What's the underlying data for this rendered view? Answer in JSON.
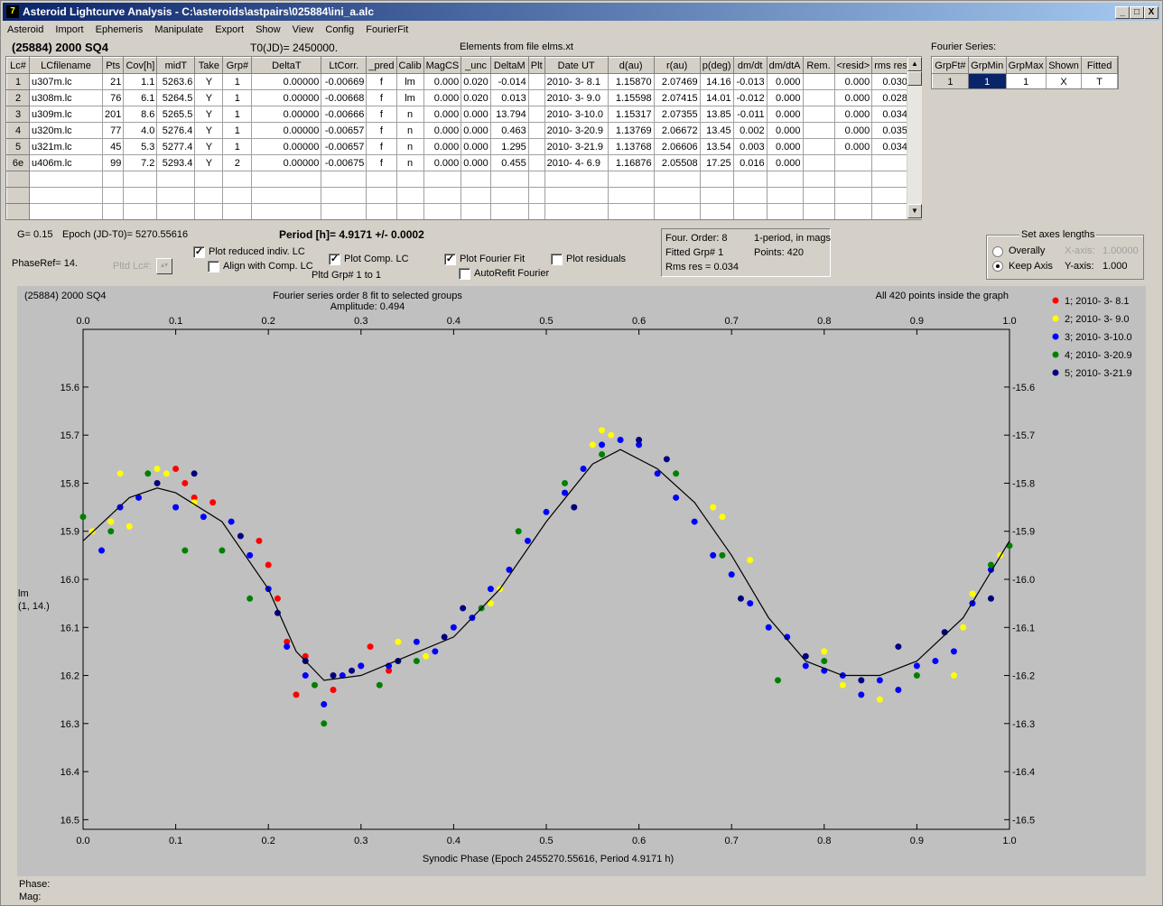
{
  "titlebar": {
    "icon_label": "7",
    "title": "Asteroid Lightcurve Analysis - C:\\asteroids\\astpairs\\025884\\ini_a.alc",
    "min_label": "_",
    "max_label": "□",
    "close_label": "X"
  },
  "menu": [
    "Asteroid",
    "Import",
    "Ephemeris",
    "Manipulate",
    "Export",
    "Show",
    "View",
    "Config",
    "FourierFit"
  ],
  "header": {
    "asteroid": "(25884) 2000 SQ4",
    "t0": "T0(JD)= 2450000.",
    "elements": "Elements from file elms.xt"
  },
  "lc_table": {
    "columns": [
      "Lc#",
      "LCfilename",
      "Pts",
      "Cov[h]",
      "midT",
      "Take",
      "Grp#",
      "DeltaT",
      "LtCorr.",
      "_pred",
      "Calib",
      "MagCS",
      "_unc",
      "DeltaM",
      "Plt",
      "Date UT",
      "d(au)",
      "r(au)",
      "p(deg)",
      "dm/dt",
      "dm/dtA",
      "Rem.",
      "<resid>",
      "rms res"
    ],
    "rows": [
      [
        "1",
        "u307m.lc",
        "21",
        "1.1",
        "5263.6",
        "Y",
        "1",
        "0.00000",
        "-0.00669",
        "f",
        "lm",
        "0.000",
        "0.020",
        "-0.014",
        "",
        "2010- 3- 8.1",
        "1.15870",
        "2.07469",
        "14.16",
        "-0.013",
        "0.000",
        "",
        "0.000",
        "0.030"
      ],
      [
        "2",
        "u308m.lc",
        "76",
        "6.1",
        "5264.5",
        "Y",
        "1",
        "0.00000",
        "-0.00668",
        "f",
        "lm",
        "0.000",
        "0.020",
        "0.013",
        "",
        "2010- 3- 9.0",
        "1.15598",
        "2.07415",
        "14.01",
        "-0.012",
        "0.000",
        "",
        "0.000",
        "0.028"
      ],
      [
        "3",
        "u309m.lc",
        "201",
        "8.6",
        "5265.5",
        "Y",
        "1",
        "0.00000",
        "-0.00666",
        "f",
        "n",
        "0.000",
        "0.000",
        "13.794",
        "",
        "2010- 3-10.0",
        "1.15317",
        "2.07355",
        "13.85",
        "-0.011",
        "0.000",
        "",
        "0.000",
        "0.034"
      ],
      [
        "4",
        "u320m.lc",
        "77",
        "4.0",
        "5276.4",
        "Y",
        "1",
        "0.00000",
        "-0.00657",
        "f",
        "n",
        "0.000",
        "0.000",
        "0.463",
        "",
        "2010- 3-20.9",
        "1.13769",
        "2.06672",
        "13.45",
        "0.002",
        "0.000",
        "",
        "0.000",
        "0.035"
      ],
      [
        "5",
        "u321m.lc",
        "45",
        "5.3",
        "5277.4",
        "Y",
        "1",
        "0.00000",
        "-0.00657",
        "f",
        "n",
        "0.000",
        "0.000",
        "1.295",
        "",
        "2010- 3-21.9",
        "1.13768",
        "2.06606",
        "13.54",
        "0.003",
        "0.000",
        "",
        "0.000",
        "0.034"
      ],
      [
        "6e",
        "u406m.lc",
        "99",
        "7.2",
        "5293.4",
        "Y",
        "2",
        "0.00000",
        "-0.00675",
        "f",
        "n",
        "0.000",
        "0.000",
        "0.455",
        "",
        "2010- 4- 6.9",
        "1.16876",
        "2.05508",
        "17.25",
        "0.016",
        "0.000",
        "",
        "",
        ""
      ]
    ]
  },
  "fourier_series": {
    "title": "Fourier Series:",
    "columns": [
      "GrpFt#",
      "GrpMin",
      "GrpMax",
      "Shown",
      "Fitted"
    ],
    "row": [
      "1",
      "1",
      "1",
      "X",
      "T"
    ]
  },
  "controls": {
    "g_value": "G= 0.15",
    "epoch": "Epoch (JD-T0)= 5270.55616",
    "period": "Period [h]= 4.9171 +/- 0.0002",
    "phaseref": "PhaseRef= 14.",
    "pltd_lc": "Pltd Lc#:",
    "plot_reduced": "Plot reduced indiv. LC",
    "align_comp": "Align with Comp. LC",
    "plot_comp": "Plot Comp. LC",
    "pltd_grp": "Pltd Grp#  1   to   1",
    "plot_fourier": "Plot Fourier Fit",
    "autorefit": "AutoRefit Fourier",
    "plot_residuals": "Plot residuals",
    "four_order": "Four. Order:  8",
    "one_period": "1-period, in mags",
    "fitted_grp": "Fitted Grp# 1",
    "points": "Points: 420",
    "rms_res": "Rms res      = 0.034",
    "axes_title": "Set axes lengths",
    "overally": "Overally",
    "keep_axis": "Keep Axis",
    "xaxis_label": "X-axis:",
    "xaxis_value": "1.00000",
    "yaxis_label": "Y-axis:",
    "yaxis_value": "1.000"
  },
  "status": {
    "phase": "Phase:",
    "mag": "Mag:"
  },
  "colors": {
    "group1": "#ff0000",
    "group2": "#ffff00",
    "group3": "#0000ff",
    "group4": "#008000",
    "group5": "#000080",
    "plot_bg": "#c0c0c0"
  },
  "chart_data": {
    "type": "scatter",
    "top_left": "(25884) 2000 SQ4",
    "title": "Fourier series order 8 fit to selected groups",
    "subtitle": "Amplitude: 0.494",
    "top_right": "All 420 points inside the graph",
    "xlabel": "Synodic Phase (Epoch 2455270.55616, Period 4.9171 h)",
    "ylabel": "lm",
    "ylabel2": "(1, 14.)",
    "xlim": [
      0.0,
      1.0
    ],
    "ylim": [
      16.52,
      15.48
    ],
    "xticks": [
      "0.0",
      "0.1",
      "0.2",
      "0.3",
      "0.4",
      "0.5",
      "0.6",
      "0.7",
      "0.8",
      "0.9",
      "1.0"
    ],
    "yticks": [
      "15.6",
      "15.7",
      "15.8",
      "15.9",
      "16.0",
      "16.1",
      "16.2",
      "16.3",
      "16.4",
      "16.5"
    ],
    "legend": [
      "1; 2010- 3- 8.1",
      "2; 2010- 3- 9.0",
      "3; 2010- 3-10.0",
      "4; 2010- 3-20.9",
      "5; 2010- 3-21.9"
    ],
    "fit_curve": [
      [
        0.0,
        15.92
      ],
      [
        0.05,
        15.83
      ],
      [
        0.08,
        15.81
      ],
      [
        0.1,
        15.82
      ],
      [
        0.15,
        15.88
      ],
      [
        0.2,
        16.02
      ],
      [
        0.23,
        16.15
      ],
      [
        0.26,
        16.21
      ],
      [
        0.3,
        16.2
      ],
      [
        0.35,
        16.16
      ],
      [
        0.4,
        16.12
      ],
      [
        0.45,
        16.02
      ],
      [
        0.5,
        15.88
      ],
      [
        0.55,
        15.76
      ],
      [
        0.58,
        15.73
      ],
      [
        0.62,
        15.77
      ],
      [
        0.66,
        15.84
      ],
      [
        0.7,
        15.95
      ],
      [
        0.74,
        16.08
      ],
      [
        0.78,
        16.17
      ],
      [
        0.82,
        16.2
      ],
      [
        0.86,
        16.2
      ],
      [
        0.9,
        16.17
      ],
      [
        0.95,
        16.08
      ],
      [
        1.0,
        15.92
      ]
    ],
    "series": [
      {
        "name": "1; 2010- 3- 8.1",
        "points": [
          [
            0.1,
            15.77
          ],
          [
            0.11,
            15.8
          ],
          [
            0.12,
            15.83
          ],
          [
            0.14,
            15.84
          ],
          [
            0.19,
            15.92
          ],
          [
            0.2,
            15.97
          ],
          [
            0.21,
            16.04
          ],
          [
            0.22,
            16.13
          ],
          [
            0.23,
            16.24
          ],
          [
            0.24,
            16.16
          ],
          [
            0.27,
            16.23
          ],
          [
            0.3,
            16.18
          ],
          [
            0.31,
            16.14
          ],
          [
            0.33,
            16.19
          ]
        ]
      },
      {
        "name": "2; 2010- 3- 9.0",
        "points": [
          [
            0.01,
            15.9
          ],
          [
            0.03,
            15.88
          ],
          [
            0.04,
            15.78
          ],
          [
            0.05,
            15.89
          ],
          [
            0.08,
            15.77
          ],
          [
            0.09,
            15.78
          ],
          [
            0.12,
            15.84
          ],
          [
            0.34,
            16.13
          ],
          [
            0.37,
            16.16
          ],
          [
            0.44,
            16.05
          ],
          [
            0.45,
            16.02
          ],
          [
            0.55,
            15.72
          ],
          [
            0.56,
            15.69
          ],
          [
            0.57,
            15.7
          ],
          [
            0.68,
            15.85
          ],
          [
            0.69,
            15.87
          ],
          [
            0.72,
            15.96
          ],
          [
            0.8,
            16.15
          ],
          [
            0.82,
            16.22
          ],
          [
            0.86,
            16.25
          ],
          [
            0.94,
            16.2
          ],
          [
            0.95,
            16.1
          ],
          [
            0.96,
            16.03
          ],
          [
            0.98,
            15.97
          ],
          [
            0.99,
            15.95
          ]
        ]
      },
      {
        "name": "3; 2010- 3-10.0",
        "points": [
          [
            0.02,
            15.94
          ],
          [
            0.04,
            15.85
          ],
          [
            0.06,
            15.83
          ],
          [
            0.1,
            15.85
          ],
          [
            0.13,
            15.87
          ],
          [
            0.16,
            15.88
          ],
          [
            0.18,
            15.95
          ],
          [
            0.2,
            16.02
          ],
          [
            0.22,
            16.14
          ],
          [
            0.24,
            16.2
          ],
          [
            0.26,
            16.26
          ],
          [
            0.28,
            16.2
          ],
          [
            0.3,
            16.18
          ],
          [
            0.33,
            16.18
          ],
          [
            0.36,
            16.13
          ],
          [
            0.38,
            16.15
          ],
          [
            0.4,
            16.1
          ],
          [
            0.42,
            16.08
          ],
          [
            0.44,
            16.02
          ],
          [
            0.46,
            15.98
          ],
          [
            0.48,
            15.92
          ],
          [
            0.5,
            15.86
          ],
          [
            0.52,
            15.82
          ],
          [
            0.54,
            15.77
          ],
          [
            0.56,
            15.72
          ],
          [
            0.58,
            15.71
          ],
          [
            0.6,
            15.72
          ],
          [
            0.62,
            15.78
          ],
          [
            0.64,
            15.83
          ],
          [
            0.66,
            15.88
          ],
          [
            0.68,
            15.95
          ],
          [
            0.7,
            15.99
          ],
          [
            0.72,
            16.05
          ],
          [
            0.74,
            16.1
          ],
          [
            0.76,
            16.12
          ],
          [
            0.78,
            16.18
          ],
          [
            0.8,
            16.19
          ],
          [
            0.82,
            16.2
          ],
          [
            0.84,
            16.24
          ],
          [
            0.86,
            16.21
          ],
          [
            0.88,
            16.23
          ],
          [
            0.9,
            16.18
          ],
          [
            0.92,
            16.17
          ],
          [
            0.94,
            16.15
          ],
          [
            0.96,
            16.05
          ],
          [
            0.98,
            15.98
          ]
        ]
      },
      {
        "name": "4; 2010- 3-20.9",
        "points": [
          [
            0.0,
            15.87
          ],
          [
            0.03,
            15.9
          ],
          [
            0.07,
            15.78
          ],
          [
            0.11,
            15.94
          ],
          [
            0.15,
            15.94
          ],
          [
            0.18,
            16.04
          ],
          [
            0.25,
            16.22
          ],
          [
            0.26,
            16.3
          ],
          [
            0.32,
            16.22
          ],
          [
            0.36,
            16.17
          ],
          [
            0.43,
            16.06
          ],
          [
            0.47,
            15.9
          ],
          [
            0.52,
            15.8
          ],
          [
            0.56,
            15.74
          ],
          [
            0.64,
            15.78
          ],
          [
            0.69,
            15.95
          ],
          [
            0.75,
            16.21
          ],
          [
            0.8,
            16.17
          ],
          [
            0.9,
            16.2
          ],
          [
            0.98,
            15.97
          ],
          [
            1.0,
            15.93
          ]
        ]
      },
      {
        "name": "5; 2010- 3-21.9",
        "points": [
          [
            0.08,
            15.8
          ],
          [
            0.12,
            15.78
          ],
          [
            0.17,
            15.91
          ],
          [
            0.21,
            16.07
          ],
          [
            0.24,
            16.17
          ],
          [
            0.27,
            16.2
          ],
          [
            0.29,
            16.19
          ],
          [
            0.34,
            16.17
          ],
          [
            0.39,
            16.12
          ],
          [
            0.41,
            16.06
          ],
          [
            0.53,
            15.85
          ],
          [
            0.6,
            15.71
          ],
          [
            0.63,
            15.75
          ],
          [
            0.71,
            16.04
          ],
          [
            0.78,
            16.16
          ],
          [
            0.84,
            16.21
          ],
          [
            0.88,
            16.14
          ],
          [
            0.93,
            16.11
          ],
          [
            0.98,
            16.04
          ]
        ]
      }
    ]
  }
}
